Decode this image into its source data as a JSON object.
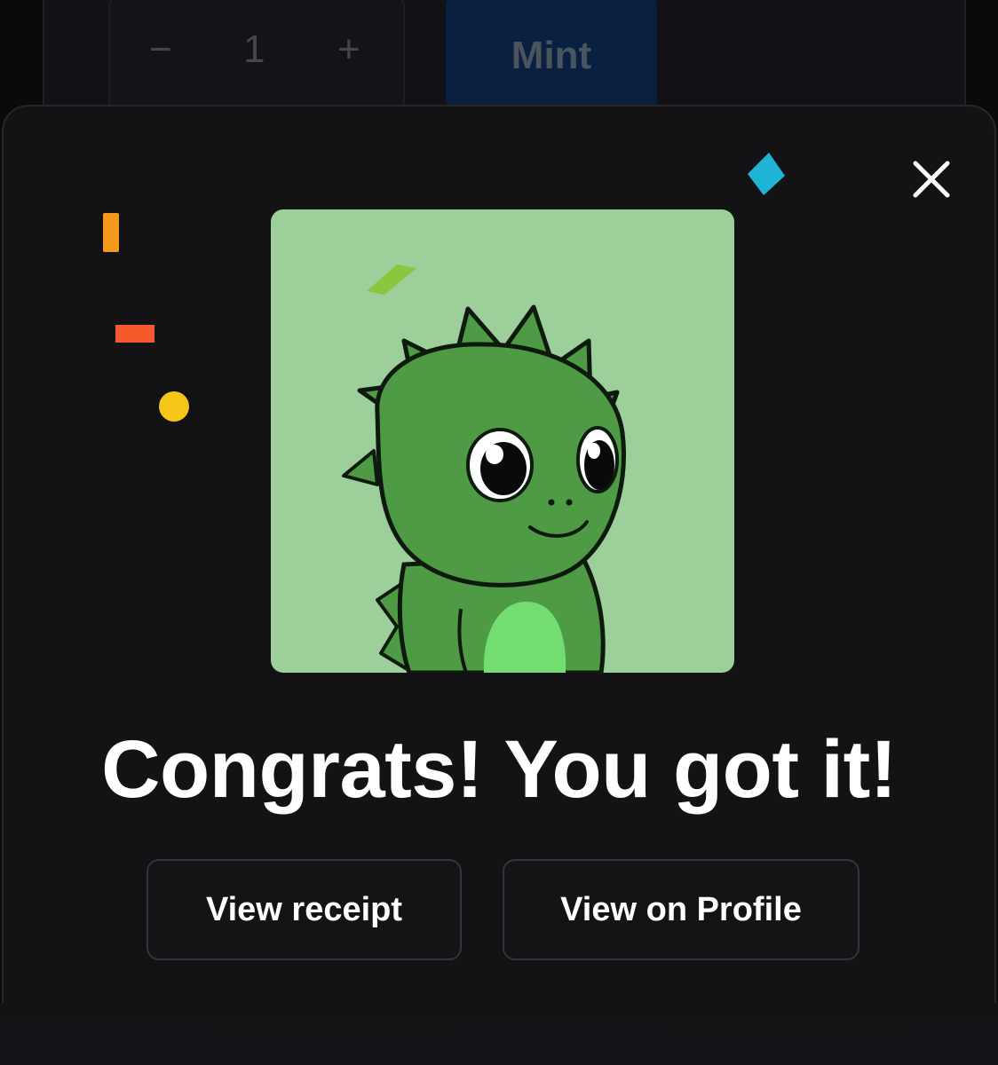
{
  "background": {
    "quantity": {
      "minus_label": "−",
      "value": "1",
      "plus_label": "+"
    },
    "mint_label": "Mint"
  },
  "modal": {
    "close_icon": "close-icon",
    "headline": "Congrats! You got it!",
    "buttons": {
      "receipt_label": "View receipt",
      "profile_label": "View on Profile"
    },
    "nft": {
      "background_color": "#9ccf9a",
      "character": "green-dinosaur"
    },
    "confetti_colors": [
      "#f59a1b",
      "#f25a2a",
      "#f5c518",
      "#1fb3d6",
      "#8cc63f"
    ]
  },
  "colors": {
    "modal_bg": "#131316",
    "mint_bg": "#0a2040",
    "text": "#ffffff"
  }
}
